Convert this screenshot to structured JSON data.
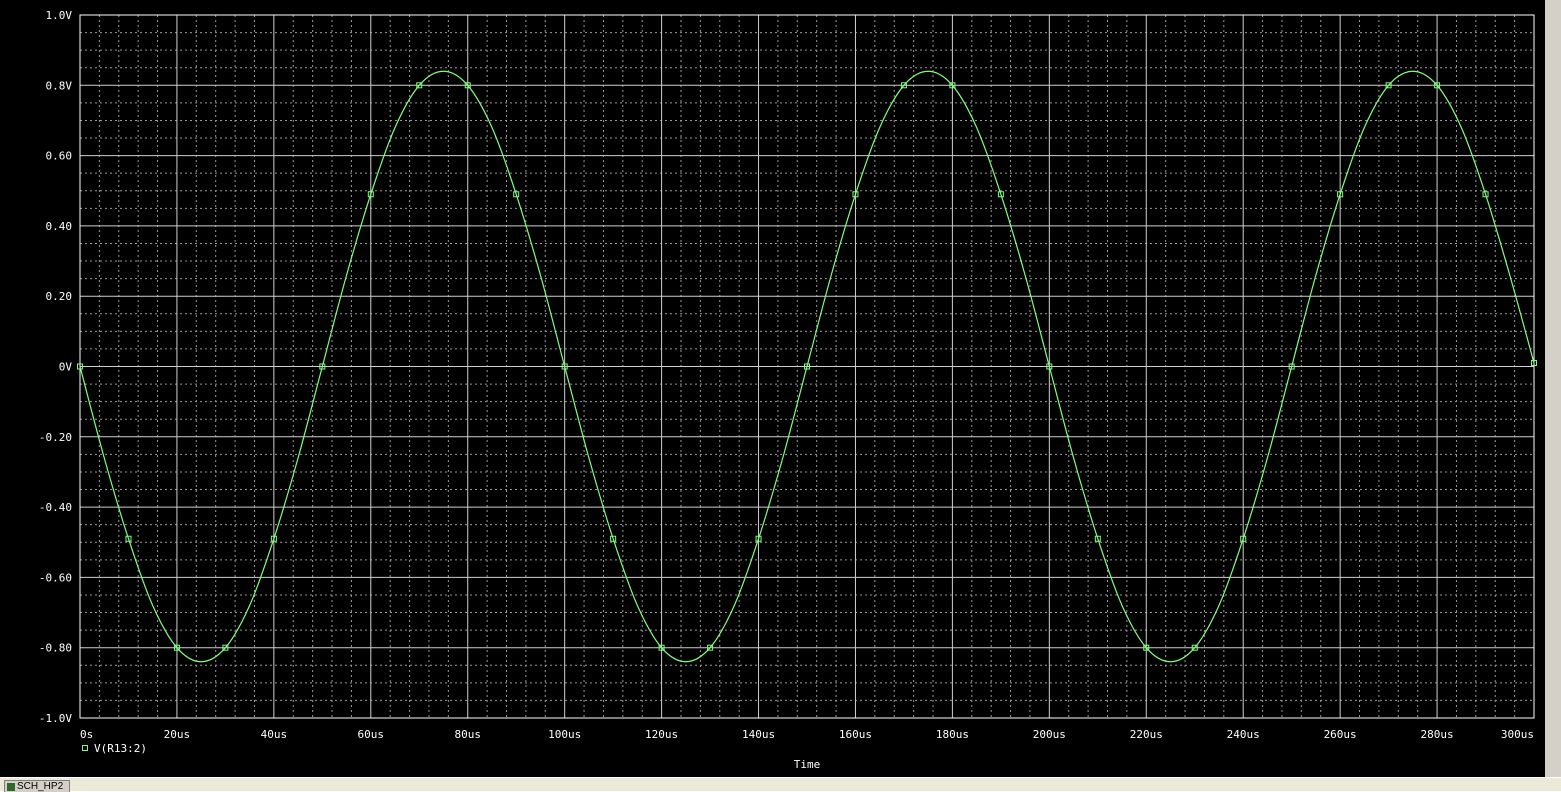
{
  "chart_data": {
    "type": "line",
    "title": "",
    "xlabel": "Time",
    "ylabel": "",
    "xlim": [
      0,
      300
    ],
    "ylim": [
      -1.0,
      1.0
    ],
    "x_tick_labels": [
      "0s",
      "20us",
      "40us",
      "60us",
      "80us",
      "100us",
      "120us",
      "140us",
      "160us",
      "180us",
      "200us",
      "220us",
      "240us",
      "260us",
      "280us",
      "300us"
    ],
    "y_tick_labels": [
      "1.0V",
      "0.8V",
      "0.60",
      "0.40",
      "0.20",
      "0V",
      "-0.20",
      "-0.40",
      "-0.60",
      "-0.80",
      "-1.0V"
    ],
    "y_tick_values": [
      1.0,
      0.8,
      0.6,
      0.4,
      0.2,
      0,
      -0.2,
      -0.4,
      -0.6,
      -0.8,
      -1.0
    ],
    "grid": true,
    "legend_position": "bottom-left",
    "series": [
      {
        "name": "V(R13:2)",
        "color": "#7fff7f",
        "x": [
          0,
          5,
          10,
          15,
          20,
          25,
          30,
          35,
          40,
          45,
          50,
          55,
          60,
          65,
          70,
          75,
          80,
          85,
          90,
          95,
          100,
          105,
          110,
          115,
          120,
          125,
          130,
          135,
          140,
          145,
          150,
          155,
          160,
          165,
          170,
          175,
          180,
          185,
          190,
          195,
          200,
          205,
          210,
          215,
          220,
          225,
          230,
          235,
          240,
          245,
          250,
          255,
          260,
          265,
          270,
          275,
          280,
          285,
          290,
          295,
          300
        ],
        "y": [
          0,
          -0.26,
          -0.49,
          -0.68,
          -0.8,
          -0.84,
          -0.8,
          -0.68,
          -0.49,
          -0.26,
          0,
          0.26,
          0.49,
          0.68,
          0.8,
          0.84,
          0.8,
          0.68,
          0.49,
          0.26,
          0,
          -0.26,
          -0.49,
          -0.68,
          -0.8,
          -0.84,
          -0.8,
          -0.68,
          -0.49,
          -0.26,
          0,
          0.26,
          0.49,
          0.68,
          0.8,
          0.84,
          0.8,
          0.68,
          0.49,
          0.26,
          0,
          -0.26,
          -0.49,
          -0.68,
          -0.8,
          -0.84,
          -0.8,
          -0.68,
          -0.49,
          -0.26,
          0,
          0.26,
          0.49,
          0.68,
          0.8,
          0.84,
          0.8,
          0.68,
          0.49,
          0.26,
          0.01
        ]
      }
    ]
  },
  "taskbar": {
    "tab_label": "SCH_HP2"
  }
}
